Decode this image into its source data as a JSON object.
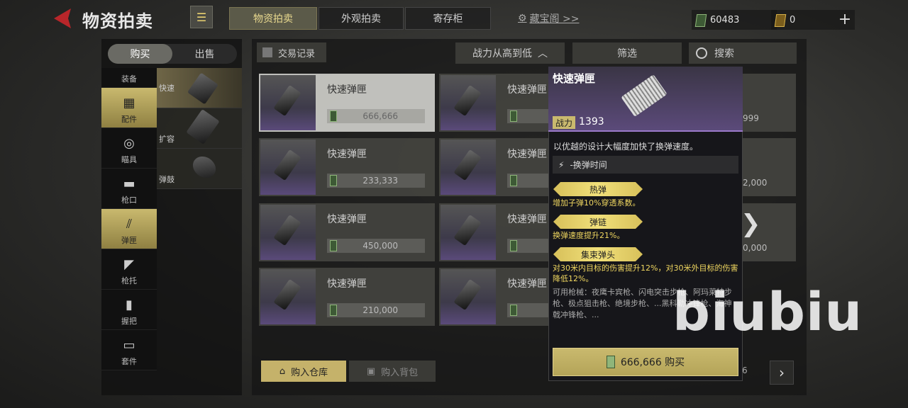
{
  "header": {
    "title": "物资拍卖",
    "tabs": [
      "物资拍卖",
      "外观拍卖",
      "寄存柜"
    ],
    "treasure_link": "藏宝阁 >>",
    "currency_a": "60483",
    "currency_b": "0",
    "add": "+"
  },
  "left": {
    "buy": "购买",
    "sell": "出售",
    "categories": [
      "装备",
      "配件",
      "瞄具",
      "枪口",
      "弹匣",
      "枪托",
      "握把",
      "套件"
    ],
    "subcategories": [
      "快速",
      "扩容",
      "弹鼓"
    ]
  },
  "toolbar": {
    "records": "交易记录",
    "sort": "战力从高到低",
    "filter": "筛选",
    "search": "搜索"
  },
  "cards": [
    {
      "name": "快速弹匣",
      "price": "666,666"
    },
    {
      "name": "快速弹匣",
      "price": ""
    },
    {
      "name": "快速弹匣",
      "price": "233,333"
    },
    {
      "name": "快速弹匣",
      "price": ""
    },
    {
      "name": "快速弹匣",
      "price": "450,000"
    },
    {
      "name": "快速弹匣",
      "price": ""
    },
    {
      "name": "快速弹匣",
      "price": "210,000"
    },
    {
      "name": "快速弹匣",
      "price": ""
    }
  ],
  "partial_prices": [
    "999",
    "2,000",
    "0,000",
    "6"
  ],
  "bottom": {
    "buy_warehouse": "购入仓库",
    "buy_backpack": "购入背包"
  },
  "popup": {
    "title": "快速弹匣",
    "power_label": "战力",
    "power_value": "1393",
    "description": "以优越的设计大幅度加快了换弹速度。",
    "effect": "-换弹时间",
    "perks": [
      {
        "name": "热弹",
        "text": "增加子弹10%穿透系数。"
      },
      {
        "name": "弹链",
        "text": "换弹速度提升21%。"
      },
      {
        "name": "集束弹头",
        "text": "对30米内目标的伤害提升12%，对30米外目标的伤害降低12%。"
      }
    ],
    "weapons": "可用枪械：夜鹰卡宾枪、闪电突击步枪、阿玛莱特步枪、极点狙击枪、绝境步枪、...黑科勒冲锋枪、海神戟冲锋枪、...",
    "buy": "666,666 购买"
  },
  "watermark": "biubiu"
}
